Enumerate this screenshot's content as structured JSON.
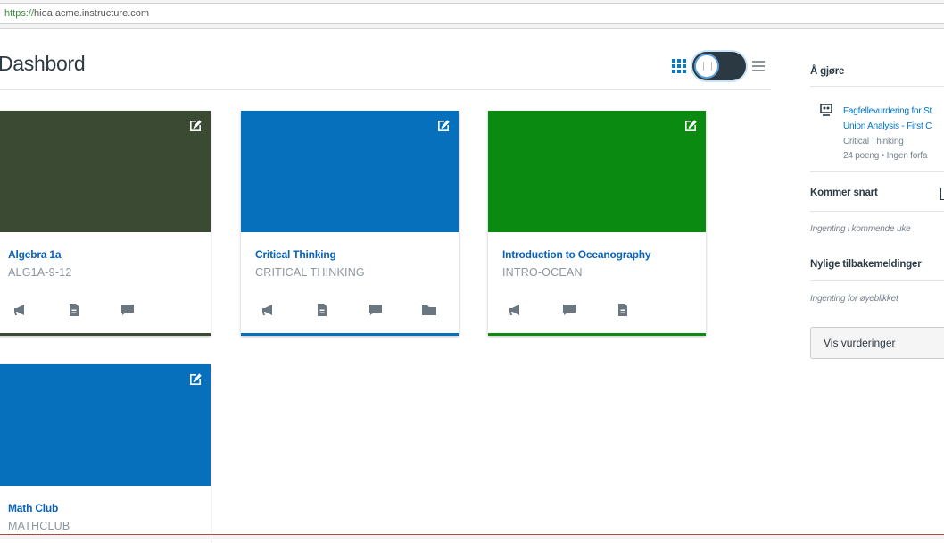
{
  "browser": {
    "url_scheme": "https://",
    "url_rest": "hioa.acme.instructure.com"
  },
  "header": {
    "title": "Dashbord"
  },
  "view_toggle": {
    "grid_icon": "grid-icon",
    "list_icon": "list-icon",
    "state": "card-view"
  },
  "courses": [
    {
      "name": "Algebra 1a",
      "code": "ALG1A-9-12",
      "color": "#3b4a33",
      "name_color": "#0a62b8",
      "icons": [
        "announcement-icon",
        "assignment-icon",
        "discussion-icon"
      ]
    },
    {
      "name": "Critical Thinking",
      "code": "CRITICAL THINKING",
      "color": "#0770bd",
      "name_color": "#0a62b8",
      "icons": [
        "announcement-icon",
        "assignment-icon",
        "discussion-icon",
        "folder-icon"
      ]
    },
    {
      "name": "Introduction to Oceanography",
      "code": "INTRO-OCEAN",
      "color": "#0a8a10",
      "name_color": "#0a62b8",
      "icons": [
        "announcement-icon",
        "discussion-icon",
        "assignment-icon"
      ]
    },
    {
      "name": "Math Club",
      "code": "MATHCLUB",
      "color": "#0770bd",
      "name_color": "#0a62b8",
      "icons": []
    }
  ],
  "sidebar": {
    "todo_heading": "Å gjøre",
    "todo_item": {
      "line1": "Fagfellevurdering for St",
      "line2": "Union Analysis - First C",
      "course": "Critical Thinking",
      "meta": "24 poeng • Ingen forfa"
    },
    "upcoming_heading": "Kommer snart",
    "upcoming_empty": "Ingenting i kommende uke",
    "feedback_heading": "Nylige tilbakemeldinger",
    "feedback_empty": "Ingenting for øyeblikket",
    "grades_button": "Vis vurderinger"
  },
  "colors": {
    "link": "#0073c0",
    "text": "#2d3b45",
    "muted": "#8b969e"
  }
}
